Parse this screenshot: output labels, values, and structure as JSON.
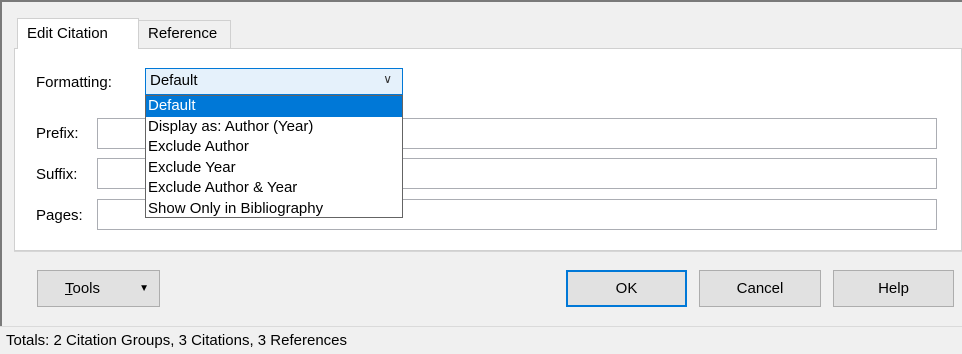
{
  "tabs": [
    {
      "label": "Edit Citation",
      "active": true
    },
    {
      "label": "Reference",
      "active": false
    }
  ],
  "form": {
    "formatting_label": "Formatting:",
    "formatting_value": "Default",
    "prefix_label": "Prefix:",
    "suffix_label": "Suffix:",
    "pages_label": "Pages:"
  },
  "dropdown": {
    "options": [
      "Default",
      "Display as: Author (Year)",
      "Exclude Author",
      "Exclude Year",
      "Exclude Author & Year",
      "Show Only in Bibliography"
    ],
    "selected_index": 0
  },
  "buttons": {
    "tools_prefix": "",
    "tools_mnemonic": "T",
    "tools_rest": "ools",
    "ok": "OK",
    "cancel": "Cancel",
    "help": "Help"
  },
  "icons": {
    "combo_chevron": "chevron-down-icon",
    "tools_arrow": "caret-down-icon"
  },
  "colors": {
    "selection": "#0078d7",
    "combo_bg": "#e5f1fb"
  },
  "status": "Totals: 2 Citation Groups, 3 Citations, 3 References"
}
